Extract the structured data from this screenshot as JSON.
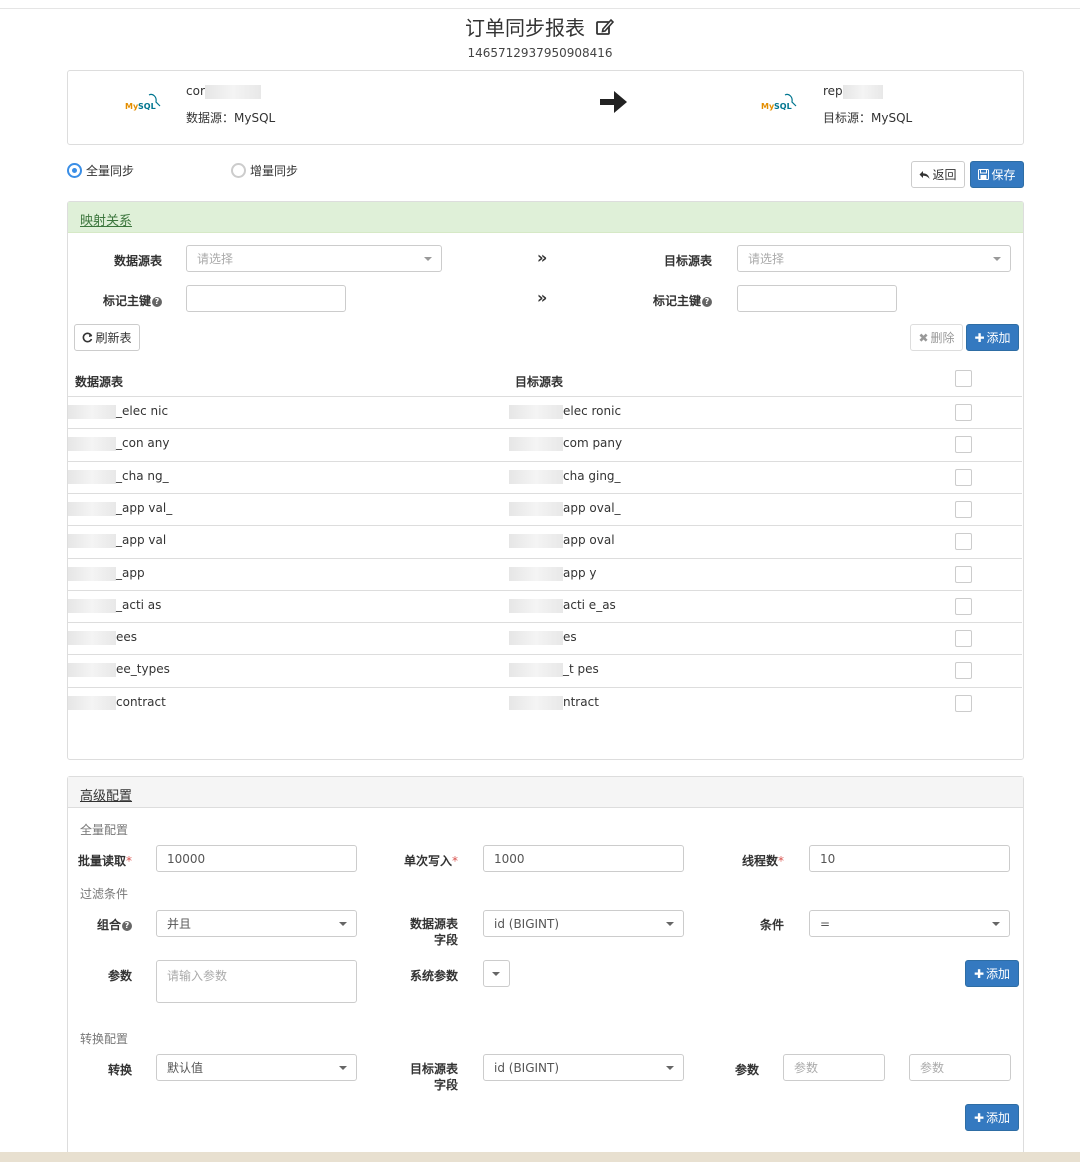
{
  "page": {
    "title": "订单同步报表",
    "subtitle": "1465712937950908416"
  },
  "source": {
    "logo": "MySQL",
    "name": "cor",
    "type_label": "数据源：MySQL"
  },
  "target": {
    "logo": "MySQL",
    "name": "rep",
    "type_label": "目标源：MySQL"
  },
  "sync_mode": {
    "full": "全量同步",
    "incremental": "增量同步",
    "selected": "full"
  },
  "actions": {
    "back": "返回",
    "save": "保存"
  },
  "mapping": {
    "title": "映射关系",
    "source_table_label": "数据源表",
    "source_table_placeholder": "请选择",
    "target_table_label": "目标源表",
    "target_table_placeholder": "请选择",
    "source_pk_label": "标记主键",
    "target_pk_label": "标记主键",
    "refresh": "刷新表",
    "delete": "删除",
    "add": "添加",
    "columns": [
      "数据源表",
      "目标源表"
    ],
    "rows": [
      {
        "source": "_elec  nic",
        "target": "elec ronic"
      },
      {
        "source": "_con  any",
        "target": "com pany"
      },
      {
        "source": "_cha  ng_",
        "target": "cha ging_"
      },
      {
        "source": "_app  val_",
        "target": "app oval_"
      },
      {
        "source": "_app  val",
        "target": "app oval"
      },
      {
        "source": "_app",
        "target": "app y"
      },
      {
        "source": "_acti  as",
        "target": "acti e_as"
      },
      {
        "source": "ees",
        "target": "es"
      },
      {
        "source": "ee_types",
        "target": "_t pes"
      },
      {
        "source": "contract",
        "target": "ntract"
      }
    ]
  },
  "advanced": {
    "title": "高级配置",
    "full_config": "全量配置",
    "batch_read_label": "批量读取",
    "batch_read_value": "10000",
    "single_write_label": "单次写入",
    "single_write_value": "1000",
    "threads_label": "线程数",
    "threads_value": "10",
    "filter_section": "过滤条件",
    "combine_label": "组合",
    "combine_value": "并且",
    "source_field_label_1": "数据源表",
    "source_field_label_2": "字段",
    "source_field_value": "id (BIGINT)",
    "condition_label": "条件",
    "condition_value": "=",
    "param_label": "参数",
    "param_placeholder": "请输入参数",
    "sys_param_label": "系统参数",
    "add": "添加",
    "convert_section": "转换配置",
    "convert_label": "转换",
    "convert_value": "默认值",
    "target_field_label_1": "目标源表",
    "target_field_label_2": "字段",
    "target_field_value": "id (BIGINT)",
    "convert_param_label": "参数",
    "convert_param_placeholder_1": "参数",
    "convert_param_placeholder_2": "参数",
    "add2": "添加"
  },
  "colors": {
    "primary": "#3479c0",
    "panel_green": "#dff0d8",
    "radio_on": "#3a8ee6"
  }
}
